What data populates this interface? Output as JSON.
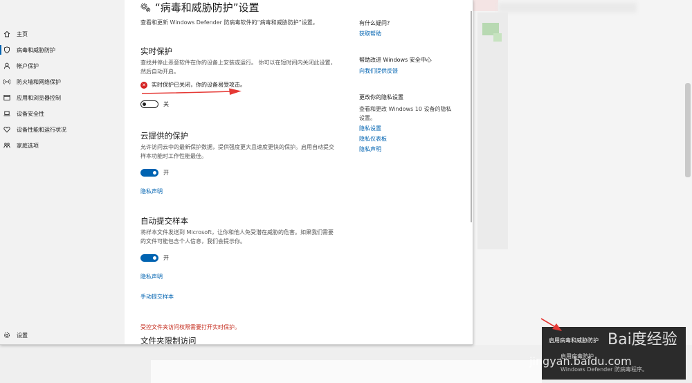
{
  "sidebar": {
    "items": [
      {
        "label": "主页",
        "icon": "home-icon"
      },
      {
        "label": "病毒和威胁防护",
        "icon": "shield-icon"
      },
      {
        "label": "帐户保护",
        "icon": "person-icon"
      },
      {
        "label": "防火墙和网络保护",
        "icon": "wifi-icon"
      },
      {
        "label": "应用和浏览器控制",
        "icon": "app-window-icon"
      },
      {
        "label": "设备安全性",
        "icon": "laptop-icon"
      },
      {
        "label": "设备性能和运行状况",
        "icon": "heart-icon"
      },
      {
        "label": "家庭选项",
        "icon": "family-icon"
      }
    ],
    "settings_label": "设置"
  },
  "page": {
    "title": "“病毒和威胁防护”设置",
    "subtitle": "查看和更新 Windows Defender 防病毒软件的“病毒和威胁防护”设置。"
  },
  "realtime": {
    "heading": "实时保护",
    "desc": "查找并停止恶意软件在你的设备上安装或运行。 你可以在短时间内关闭此设置，然后自动开启。",
    "warning": "实时保护已关闭，你的设备易受攻击。",
    "toggle_label": "关"
  },
  "cloud": {
    "heading": "云提供的保护",
    "desc": "允许访问云中的最新保护数据，提供强度更大且速度更快的保护。启用自动提交样本功能时工作性能最佳。",
    "toggle_label": "开",
    "privacy_link": "隐私声明"
  },
  "sample": {
    "heading": "自动提交样本",
    "desc": "将样本文件发送到 Microsoft，让你和他人免受潜在威胁的危害。如果我们需要的文件可能包含个人信息，我们会提示你。",
    "toggle_label": "开",
    "privacy_link": "隐私声明",
    "manual_link": "手动提交样本"
  },
  "folder": {
    "note": "受控文件夹访问权限需要打开实时保护。",
    "heading": "文件夹限制访问"
  },
  "right": {
    "q_heading": "有什么疑问?",
    "q_link": "获取帮助",
    "improve_heading": "帮助改进 Windows 安全中心",
    "improve_link": "向我们提供反馈",
    "privacy_heading": "更改你的隐私设置",
    "privacy_text": "查看和更改 Windows 10 设备的隐私设置。",
    "privacy_links": [
      "隐私设置",
      "隐私仪表板",
      "隐私声明"
    ]
  },
  "toast": {
    "line1": "启用病毒和威胁防护",
    "line2": "启用病毒防护",
    "line3": "Windows Defender 防病毒程序。"
  },
  "watermark": {
    "line1": "Bai度经验",
    "line2": "jingyan.baidu.com"
  },
  "colors": {
    "accent": "#0063b1",
    "error": "#d42020",
    "warning_text": "#c42b1c"
  }
}
